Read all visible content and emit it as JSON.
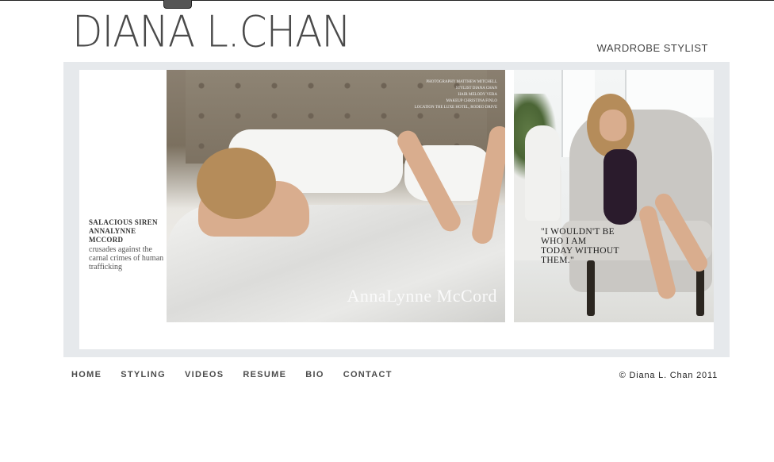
{
  "header": {
    "logo_text": "DIANA L.CHAN",
    "tagline": "WARDROBE STYLIST"
  },
  "feature": {
    "caption_headline": "SALACIOUS SIREN ANNALYNNE MCCORD",
    "caption_sub": "crusades against the carnal crimes of human trafficking",
    "credits": [
      "PHOTOGRAPHY MATTHEW MITCHELL",
      "STYLIST DIANA CHAN",
      "HAIR MELODY VERA",
      "MAKEUP CHRISTINA FINLO",
      "LOCATION THE LUXE HOTEL, RODEO DRIVE"
    ],
    "name_overlay": "AnnaLynne McCord",
    "quote": "\"I WOULDN'T BE WHO I AM TODAY WITHOUT THEM.\""
  },
  "nav": {
    "items": [
      "HOME",
      "STYLING",
      "VIDEOS",
      "RESUME",
      "BIO",
      "CONTACT"
    ]
  },
  "footer": {
    "copyright": "© Diana L. Chan 2011"
  },
  "colors": {
    "frame": "#e6e9ec",
    "text": "#4c4c4c"
  }
}
